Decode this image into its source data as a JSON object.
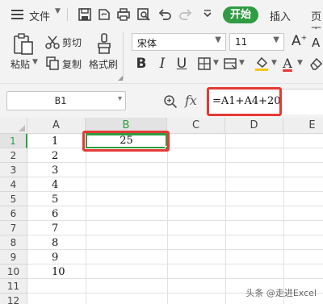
{
  "menu": {
    "file_label": "文件",
    "tabs": [
      "开始",
      "插入",
      "页面"
    ]
  },
  "ribbon": {
    "paste_label": "粘贴",
    "cut_label": "剪切",
    "copy_label": "复制",
    "format_painter_label": "格式刷",
    "font_name": "宋体",
    "font_size": "11",
    "bold_label": "B",
    "italic_label": "I",
    "underline_label": "U",
    "font_color_label": "A",
    "grow_font_label": "A",
    "shrink_font_label": "A",
    "colors": {
      "font_color": "#e53935",
      "fill_color": "#f5c518",
      "accent": "#2f9b42"
    }
  },
  "formula_bar": {
    "name_box": "B1",
    "fx_label": "fx",
    "formula": "=A1+A4+20"
  },
  "sheet": {
    "columns": [
      "A",
      "B",
      "C",
      "D",
      "E"
    ],
    "selected_column": "B",
    "rows": [
      "1",
      "2",
      "3",
      "4",
      "5",
      "6",
      "7",
      "8",
      "9",
      "10",
      "11",
      "12"
    ],
    "column_a_values": [
      "1",
      "2",
      "3",
      "4",
      "5",
      "6",
      "7",
      "8",
      "9",
      "10"
    ],
    "active_cell_value": "25"
  },
  "watermark": "头条 @走进Excel"
}
